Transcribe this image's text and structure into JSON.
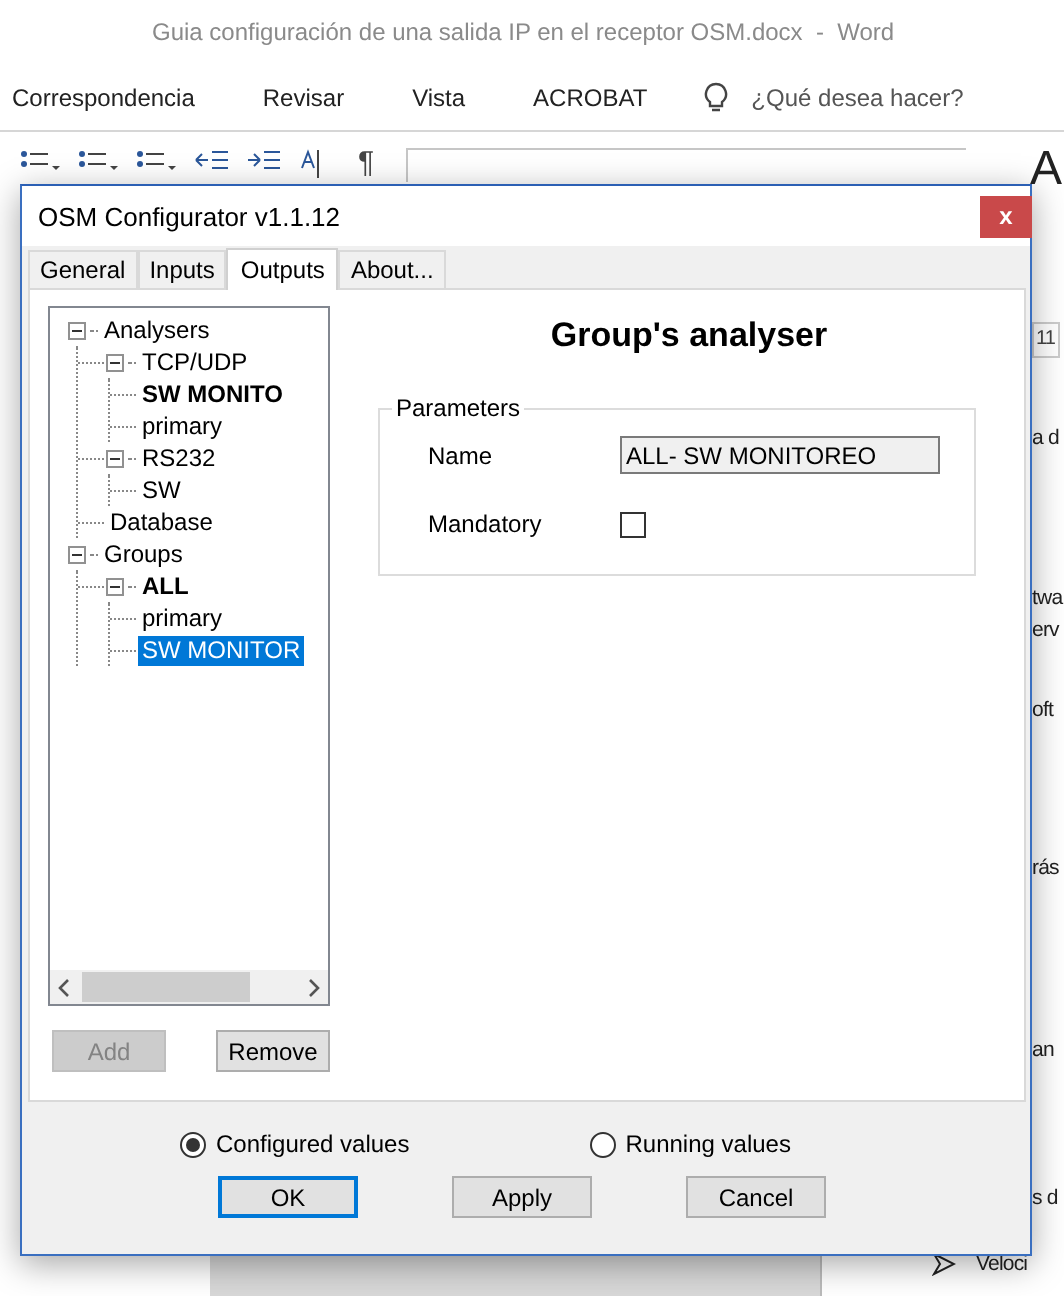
{
  "word": {
    "title": "Guia configuración de una salida IP en el receptor OSM.docx  -  Word",
    "menu": [
      {
        "label": "Correspondencia"
      },
      {
        "label": "Revisar"
      },
      {
        "label": "Vista"
      },
      {
        "label": "ACROBAT"
      }
    ],
    "tell_me": {
      "placeholder": "¿Qué desea hacer?"
    },
    "ribbon": {
      "pilcrow": "¶",
      "style_glyph": "A"
    },
    "doc_lines": [
      {
        "kind": "box",
        "text": "11"
      },
      {
        "kind": "text",
        "text": "a d"
      },
      {
        "kind": "text",
        "text": "twa"
      },
      {
        "kind": "text",
        "text": "erv"
      },
      {
        "kind": "text",
        "text": "oft"
      },
      {
        "kind": "text",
        "text": "rás"
      },
      {
        "kind": "text",
        "text": "an"
      },
      {
        "kind": "text",
        "text": "s d"
      },
      {
        "kind": "bullet",
        "text": "Veloci"
      }
    ]
  },
  "dialog": {
    "title": "OSM Configurator v1.1.12",
    "close": "x",
    "tabs": [
      {
        "label": "General",
        "selected": false
      },
      {
        "label": "Inputs",
        "selected": false
      },
      {
        "label": "Outputs",
        "selected": true
      },
      {
        "label": "About...",
        "selected": false
      }
    ],
    "tree": [
      {
        "label": "Analysers",
        "bold": false,
        "selected": false,
        "expanded": true,
        "children": [
          {
            "label": "TCP/UDP",
            "bold": false,
            "selected": false,
            "expanded": true,
            "children": [
              {
                "label": "SW MONITO",
                "bold": true,
                "selected": false
              },
              {
                "label": "primary",
                "bold": false,
                "selected": false
              }
            ]
          },
          {
            "label": "RS232",
            "bold": false,
            "selected": false,
            "expanded": true,
            "children": [
              {
                "label": "SW",
                "bold": false,
                "selected": false
              }
            ]
          },
          {
            "label": "Database",
            "bold": false,
            "selected": false
          }
        ]
      },
      {
        "label": "Groups",
        "bold": false,
        "selected": false,
        "expanded": true,
        "children": [
          {
            "label": "ALL",
            "bold": true,
            "selected": false,
            "expanded": true,
            "children": [
              {
                "label": "primary",
                "bold": false,
                "selected": false
              },
              {
                "label": "SW MONITOR",
                "bold": false,
                "selected": true
              }
            ]
          }
        ]
      }
    ],
    "tree_buttons": [
      {
        "label": "Add",
        "disabled": true
      },
      {
        "label": "Remove",
        "disabled": false
      }
    ],
    "heading": "Group's analyser",
    "group_label": "Parameters",
    "name_label": "Name",
    "name_value": "ALL- SW MONITOREO",
    "mandatory_label": "Mandatory",
    "mandatory_checked": false,
    "modes": [
      {
        "label": "Configured values",
        "selected": true
      },
      {
        "label": "Running values",
        "selected": false
      }
    ],
    "buttons": [
      {
        "label": "OK",
        "focused": true
      },
      {
        "label": "Apply",
        "focused": false
      },
      {
        "label": "Cancel",
        "focused": false
      }
    ]
  }
}
